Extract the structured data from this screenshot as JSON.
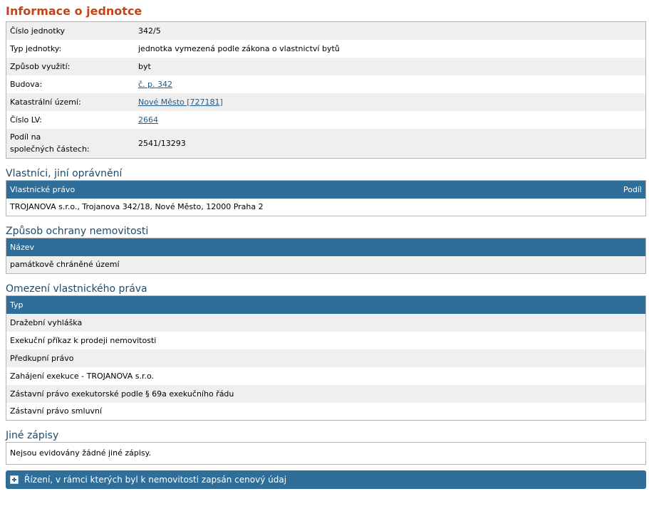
{
  "unit_info": {
    "title": "Informace o jednotce",
    "rows": [
      {
        "label": "Číslo jednotky",
        "value": "342/5",
        "link": false
      },
      {
        "label": "Typ jednotky:",
        "value": "jednotka vymezená podle zákona o vlastnictví bytů",
        "link": false
      },
      {
        "label": "Způsob využití:",
        "value": "byt",
        "link": false
      },
      {
        "label": "Budova:",
        "value": "č. p. 342",
        "link": true
      },
      {
        "label": "Katastrální území:",
        "value": "Nové Město [727181]",
        "link": true
      },
      {
        "label": "Číslo LV:",
        "value": "2664",
        "link": true
      }
    ],
    "share_label_line1": "Podíl na",
    "share_label_line2": "společných částech:",
    "share_value": "2541/13293"
  },
  "owners": {
    "title": "Vlastníci, jiní oprávnění",
    "col_left": "Vlastnické právo",
    "col_right": "Podíl",
    "rows": [
      "TROJANOVA s.r.o., Trojanova 342/18, Nové Město, 12000 Praha 2"
    ]
  },
  "protection": {
    "title": "Způsob ochrany nemovitosti",
    "col": "Název",
    "rows": [
      "památkově chráněné území"
    ]
  },
  "limits": {
    "title": "Omezení vlastnického práva",
    "col": "Typ",
    "rows": [
      "Dražební vyhláška",
      "Exekuční příkaz k prodeji nemovitosti",
      "Předkupní právo",
      "Zahájení exekuce - TROJANOVA s.r.o.",
      "Zástavní právo exekutorské podle § 69a exekučního řádu",
      "Zástavní právo smluvní"
    ]
  },
  "other": {
    "title": "Jiné zápisy",
    "text": "Nejsou evidovány žádné jiné zápisy."
  },
  "proceedings": {
    "label": "Řízení, v rámci kterých byl k nemovitosti zapsán cenový údaj"
  }
}
